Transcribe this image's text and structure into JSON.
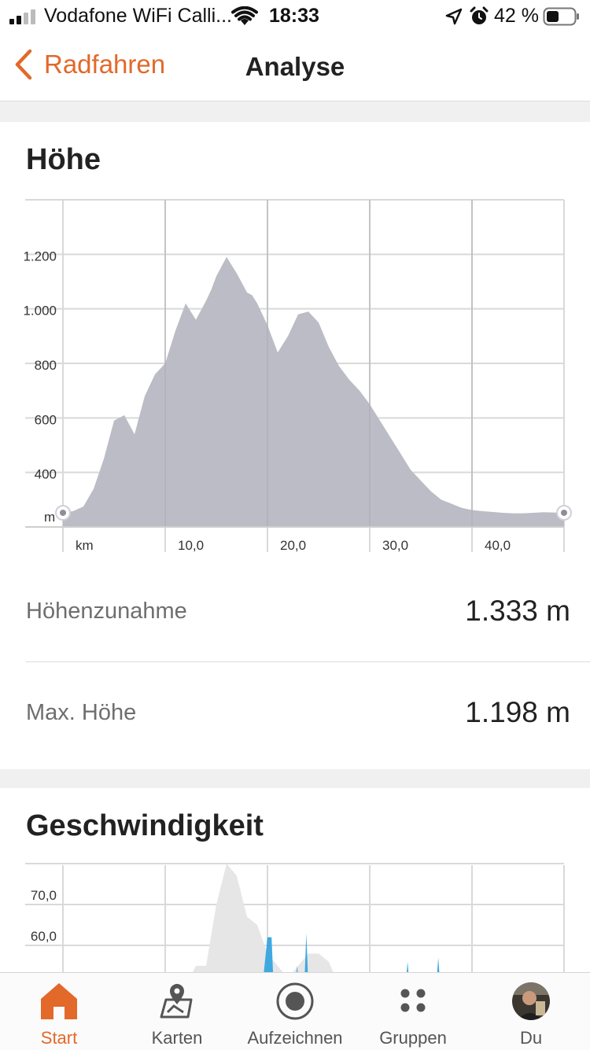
{
  "status_bar": {
    "carrier": "Vodafone WiFi Calli...",
    "time": "18:33",
    "battery": "42 %",
    "icons": [
      "signal-icon",
      "wifi-icon",
      "location-icon",
      "alarm-icon",
      "battery-icon"
    ]
  },
  "nav": {
    "back_label": "Radfahren",
    "title": "Analyse",
    "accent_color": "#e2692a"
  },
  "elevation": {
    "title": "Höhe",
    "stats": [
      {
        "label": "Höhenzunahme",
        "value": "1.333 m"
      },
      {
        "label": "Max. Höhe",
        "value": "1.198 m"
      }
    ]
  },
  "speed": {
    "title": "Geschwindigkeit"
  },
  "chart_data": [
    {
      "type": "area",
      "title": "Höhe",
      "xlabel": "km",
      "ylabel": "m",
      "x_tick_labels": [
        "10,0",
        "20,0",
        "30,0",
        "40,0"
      ],
      "y_tick_labels": [
        "400",
        "600",
        "800",
        "1.000",
        "1.200"
      ],
      "xlim": [
        0,
        49
      ],
      "ylim": [
        200,
        1400
      ],
      "color": "#bcbcc6",
      "x": [
        0,
        1,
        2,
        3,
        4,
        5,
        6,
        7,
        8,
        8.5,
        9,
        10,
        11,
        12,
        13,
        14,
        14.5,
        15,
        16,
        17,
        18,
        18.5,
        19,
        20,
        21,
        22,
        23,
        24,
        24.5,
        25,
        26,
        27,
        28,
        29,
        30,
        31,
        32,
        33,
        34,
        35,
        36,
        37,
        38,
        39,
        40,
        41,
        42,
        43,
        44,
        45,
        46,
        47,
        48,
        49
      ],
      "y": [
        252,
        258,
        275,
        340,
        450,
        590,
        610,
        540,
        680,
        720,
        760,
        800,
        920,
        1020,
        960,
        1030,
        1070,
        1120,
        1190,
        1130,
        1060,
        1050,
        1020,
        940,
        840,
        900,
        980,
        990,
        970,
        950,
        860,
        790,
        740,
        700,
        650,
        590,
        530,
        470,
        410,
        370,
        330,
        300,
        285,
        270,
        262,
        258,
        255,
        252,
        250,
        250,
        252,
        254,
        253,
        252,
        252
      ]
    },
    {
      "type": "area",
      "title": "Geschwindigkeit",
      "y_tick_labels": [
        "60,0",
        "70,0"
      ],
      "xlim": [
        0,
        49
      ],
      "ylim": [
        50,
        80
      ],
      "series": [
        {
          "color": "#e6e6e6",
          "x": [
            12,
            13,
            14,
            15,
            16,
            17,
            18,
            19,
            20,
            22,
            24,
            25,
            26,
            27,
            28
          ],
          "y": [
            50,
            55,
            55,
            70,
            80,
            77,
            67,
            65,
            58,
            52,
            58,
            58,
            56,
            50,
            50
          ]
        },
        {
          "color": "#3fa8e0",
          "x": [
            19.5,
            20,
            20.4,
            20.6,
            22.7,
            22.9,
            23.1,
            23.6,
            23.8,
            24.0,
            33.5,
            33.7,
            33.9,
            36.5,
            36.7,
            36.9
          ],
          "y": [
            50,
            62,
            62,
            50,
            50,
            55,
            50,
            50,
            63,
            50,
            50,
            56,
            50,
            50,
            57,
            50
          ]
        }
      ]
    }
  ],
  "tabs": [
    {
      "label": "Start",
      "icon": "home-icon",
      "active": true
    },
    {
      "label": "Karten",
      "icon": "map-icon",
      "active": false
    },
    {
      "label": "Aufzeichnen",
      "icon": "record-icon",
      "active": false
    },
    {
      "label": "Gruppen",
      "icon": "groups-icon",
      "active": false
    },
    {
      "label": "Du",
      "icon": "avatar-icon",
      "active": false
    }
  ]
}
